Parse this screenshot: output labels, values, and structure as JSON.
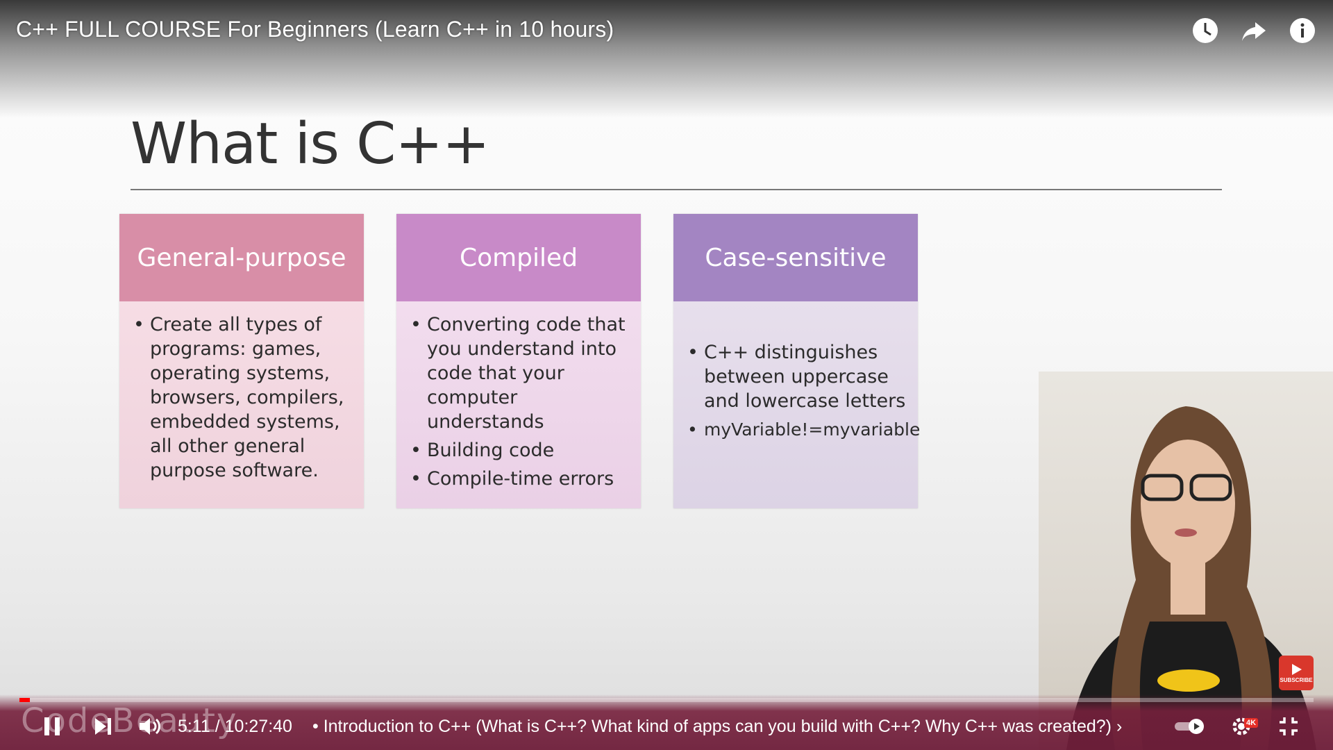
{
  "header": {
    "title": "C++ FULL COURSE For Beginners (Learn C++ in 10 hours)",
    "icons": [
      "watch-later-icon",
      "share-icon",
      "info-icon"
    ]
  },
  "slide": {
    "title": "What is C++",
    "cards": [
      {
        "heading": "General-purpose",
        "color": "#d88ea7",
        "bullets": [
          "Create all types of programs: games, operating systems, browsers, compilers, embedded systems, all other general purpose software."
        ]
      },
      {
        "heading": "Compiled",
        "color": "#c88ac8",
        "bullets": [
          "Converting code that you understand into code that your computer understands",
          "Building code",
          "Compile-time errors"
        ]
      },
      {
        "heading": "Case-sensitive",
        "color": "#a385c2",
        "bullets": [
          "C++ distinguishes between uppercase and lowercase letters",
          "myVariable!=myvariable"
        ]
      }
    ]
  },
  "overlay": {
    "watermark": "CodeBeauty",
    "subscribe_label": "SUBSCRIBE"
  },
  "player": {
    "time": "5:11 / 10:27:40",
    "chapter": "• Introduction to C++ (What is C++? What kind of apps can you build with C++? Why C++ was created?) ›",
    "quality_badge": "4K",
    "progress_fraction": 0.008,
    "accent": "#ff0000"
  }
}
